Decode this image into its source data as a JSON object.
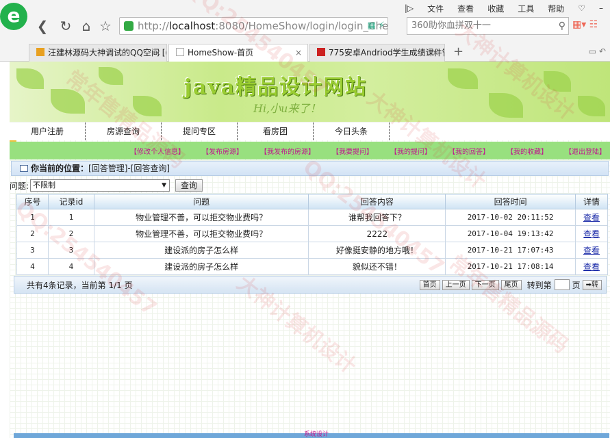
{
  "browser": {
    "menu": [
      "文件",
      "查看",
      "收藏",
      "工具",
      "帮助"
    ],
    "url_prefix": "http://",
    "url_host": "localhost",
    "url_rest": ":8080/HomeShow/login/login_Chec",
    "search_placeholder": "360助你血拼双十一",
    "tabs": [
      {
        "label": "汪建林源码大神调试的QQ空间 [(",
        "active": false,
        "favicon_color": "#e8a020"
      },
      {
        "label": "HomeShow-首页",
        "active": true,
        "favicon_color": "#ffffff"
      },
      {
        "label": "775安卓Andriod学生成绩课件管",
        "active": false,
        "favicon_color": "#cc2222"
      }
    ]
  },
  "site": {
    "title": "java精品设计网站",
    "subtitle": "Hi,小u来了！",
    "nav": [
      "用户注册",
      "房源查询",
      "提问专区",
      "看房团",
      "今日头条"
    ],
    "subnav": [
      "【修改个人信息】",
      "【发布房源】",
      "【我发布的房源】",
      "【我要提问】",
      "【我的提问】",
      "【我的回答】",
      "【我的收藏】",
      "【退出登陆】"
    ],
    "location_label": "你当前的位置：",
    "location_path": "[回答管理]-[回答查询]",
    "footer_text": "系统设计"
  },
  "filter": {
    "label": "问题:",
    "selected": "不限制",
    "button": "查询"
  },
  "table": {
    "headers": [
      "序号",
      "记录id",
      "问题",
      "回答内容",
      "回答时间",
      "详情"
    ],
    "rows": [
      {
        "no": "1",
        "id": "1",
        "question": "物业管理不善，可以拒交物业费吗？",
        "answer": "谁帮我回答下？",
        "time": "2017-10-02 20:11:52",
        "link": "查看"
      },
      {
        "no": "2",
        "id": "2",
        "question": "物业管理不善，可以拒交物业费吗？",
        "answer": "2222",
        "time": "2017-10-04 19:13:42",
        "link": "查看"
      },
      {
        "no": "3",
        "id": "3",
        "question": "建设派的房子怎么样",
        "answer": "好像挺安静的地方哦！",
        "time": "2017-10-21 17:07:43",
        "link": "查看"
      },
      {
        "no": "4",
        "id": "4",
        "question": "建设派的房子怎么样",
        "answer": "貌似还不错！",
        "time": "2017-10-21 17:08:14",
        "link": "查看"
      }
    ]
  },
  "pager": {
    "summary": "共有4条记录，当前第 1/1 页",
    "first": "首页",
    "prev": "上一页",
    "next": "下一页",
    "last": "尾页",
    "goto_label": "转到第",
    "page_unit": "页",
    "go_button": "➡转"
  },
  "watermarks": [
    "QQ:254540457",
    "大神计算机设计",
    "常年售精品源码",
    "QQ:254540457",
    "大神计算机设计",
    "常年售精品源码",
    "QQ:254540457",
    "大神计算机设计"
  ]
}
